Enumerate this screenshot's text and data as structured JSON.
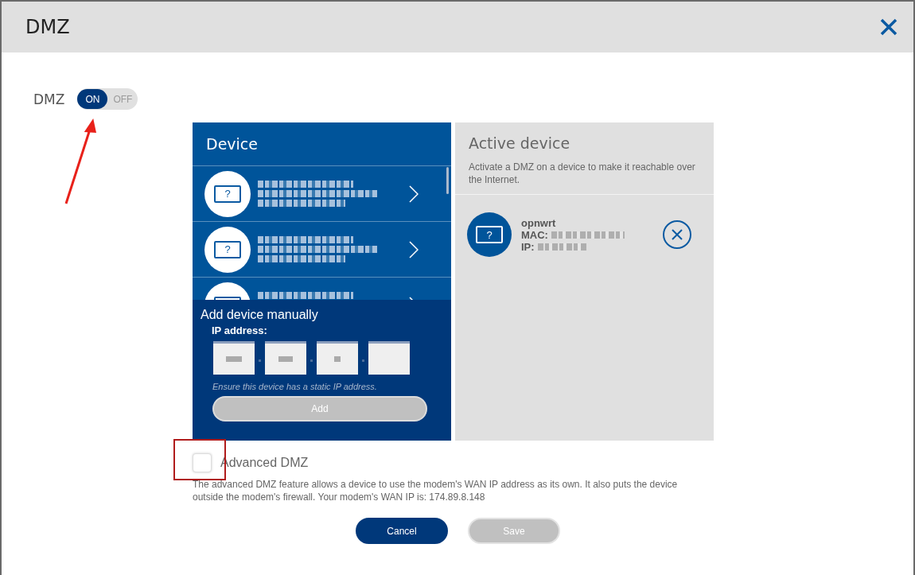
{
  "dialog": {
    "title": "DMZ"
  },
  "dmz_toggle": {
    "label": "DMZ",
    "on": true,
    "on_text": "ON",
    "off_text": "OFF"
  },
  "device_panel": {
    "title": "Device",
    "devices": [
      {
        "kind": "device",
        "icon_text": "?"
      },
      {
        "kind": "device",
        "icon_text": "?"
      },
      {
        "kind": "partial"
      }
    ]
  },
  "add_manually": {
    "title": "Add device manually",
    "ip_label": "IP address:",
    "ip_fields": [
      {
        "kind": "filled"
      },
      {
        "kind": "filled"
      },
      {
        "kind": "filled"
      },
      {
        "kind": "empty"
      }
    ],
    "hint": "Ensure this device has a static IP address.",
    "button": {
      "label": "Add",
      "disabled": true
    }
  },
  "active_panel": {
    "title": "Active device",
    "description": "Activate a DMZ on a device to make it reachable over the Internet.",
    "device": {
      "icon_text": "?",
      "name": "opnwrt",
      "mac_label": "MAC:",
      "ip_label": "IP:"
    }
  },
  "advanced": {
    "label": "Advanced DMZ",
    "checked": false,
    "description": "The advanced DMZ feature allows a device to use the modem's WAN IP address as its own. It also puts the device outside the modem's firewall. Your modem's WAN IP is: 174.89.8.148"
  },
  "buttons": [
    {
      "label": "Cancel",
      "disabled": false
    },
    {
      "label": "Save",
      "disabled": true
    }
  ],
  "annotations": [
    {
      "kind": "arrow"
    },
    {
      "kind": "box"
    }
  ]
}
